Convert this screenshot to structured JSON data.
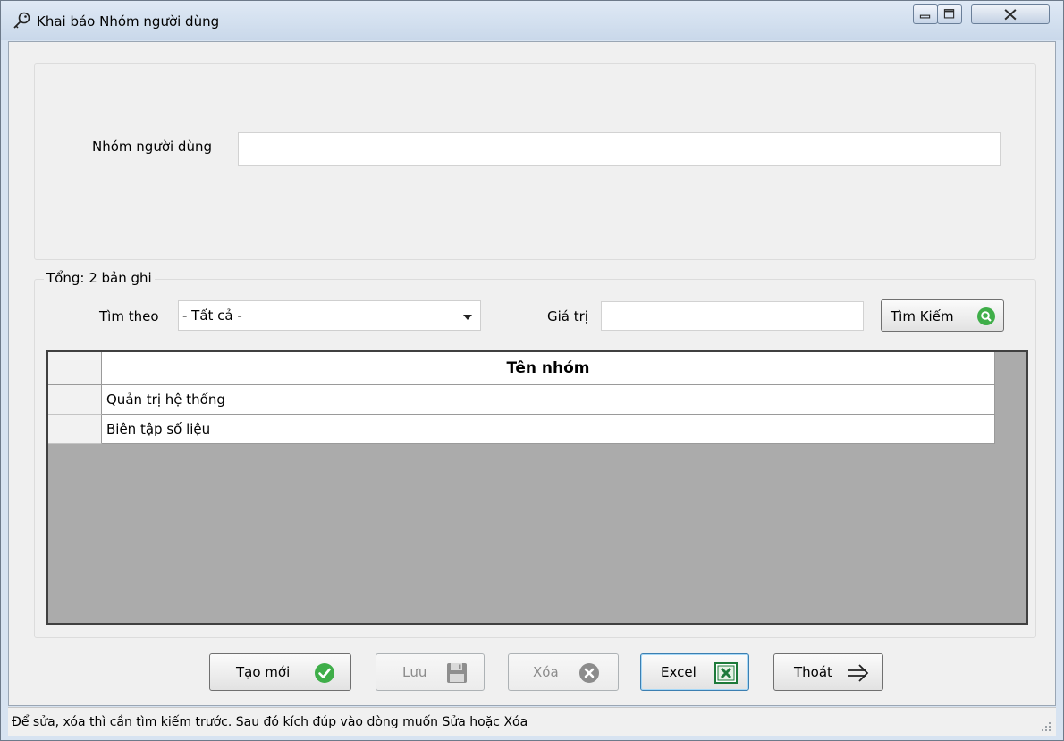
{
  "window": {
    "title": "Khai báo Nhóm người dùng",
    "icon": "key-icon",
    "controls": {
      "minimize": "minimize-icon",
      "maximize": "maximize-icon",
      "close": "close-icon"
    }
  },
  "form": {
    "group_label": "Nhóm người dùng",
    "group_value": ""
  },
  "search": {
    "total_label": "Tổng: 2 bản ghi",
    "by_label": "Tìm theo",
    "by_selected": "- Tất cả -",
    "value_label": "Giá trị",
    "value": "",
    "button_label": "Tìm Kiếm",
    "button_icon": "search-icon"
  },
  "grid": {
    "column_header": "Tên nhóm",
    "rows": [
      "Quản trị hệ thống",
      "Biên tập số liệu"
    ]
  },
  "actions": {
    "new_label": "Tạo mới",
    "save_label": "Lưu",
    "delete_label": "Xóa",
    "excel_label": "Excel",
    "exit_label": "Thoát"
  },
  "status": {
    "text": "Để sửa, xóa thì cần tìm kiếm trước. Sau đó kích đúp vào dòng muốn Sửa hoặc Xóa"
  },
  "colors": {
    "accent_green": "#3fae49",
    "excel_green": "#1d7a3a",
    "disabled_gray": "#8c8c8c",
    "grid_bg": "#ababab"
  }
}
